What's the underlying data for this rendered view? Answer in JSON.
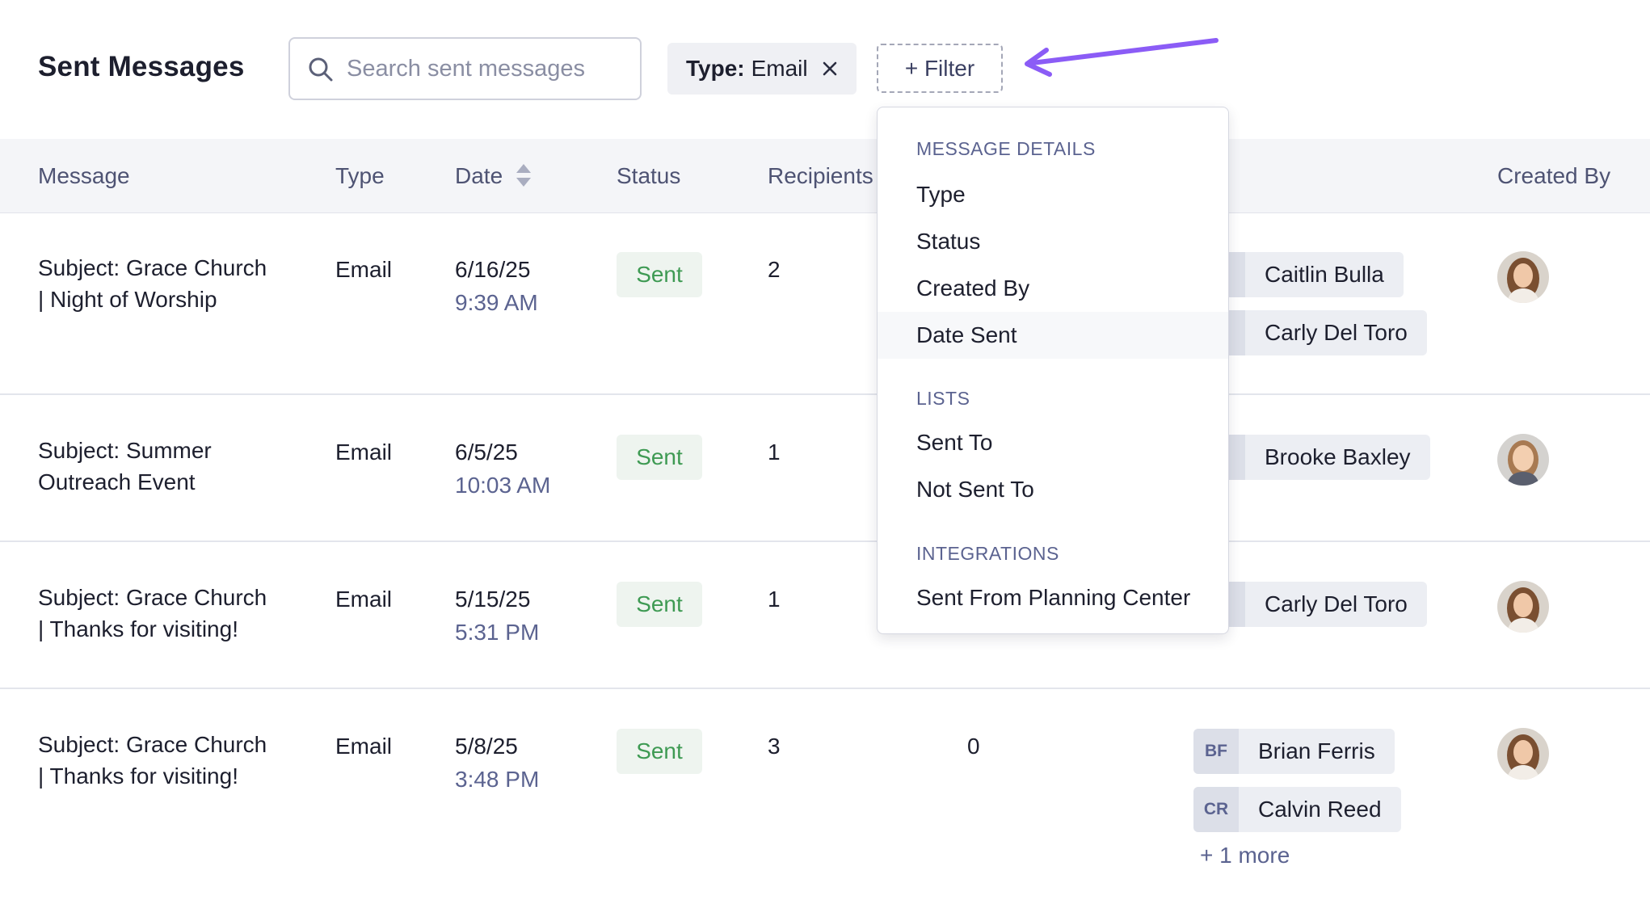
{
  "header": {
    "title": "Sent Messages",
    "search_placeholder": "Search sent messages",
    "type_filter": {
      "key": "Type:",
      "value": "Email"
    },
    "filter_button": "+ Filter"
  },
  "table": {
    "columns": {
      "message": "Message",
      "type": "Type",
      "date": "Date",
      "status": "Status",
      "recipients": "Recipients",
      "created_by": "Created By"
    },
    "rows": [
      {
        "subject_line1": "Subject: Grace Church",
        "subject_line2": "| Night of Worship",
        "type": "Email",
        "date": "6/16/25",
        "time": "9:39 AM",
        "status": "Sent",
        "recipients": "2",
        "sent_to": [
          {
            "initials": "",
            "name": "Caitlin Bulla"
          },
          {
            "initials": "",
            "name": "Carly Del Toro"
          }
        ]
      },
      {
        "subject_line1": "Subject: Summer",
        "subject_line2": "Outreach Event",
        "type": "Email",
        "date": "6/5/25",
        "time": "10:03 AM",
        "status": "Sent",
        "recipients": "1",
        "sent_to": [
          {
            "initials": "",
            "name": "Brooke Baxley"
          }
        ]
      },
      {
        "subject_line1": "Subject: Grace Church",
        "subject_line2": "| Thanks for visiting!",
        "type": "Email",
        "date": "5/15/25",
        "time": "5:31 PM",
        "status": "Sent",
        "recipients": "1",
        "sent_to": [
          {
            "initials": "",
            "name": "Carly Del Toro"
          }
        ]
      },
      {
        "subject_line1": "Subject: Grace Church",
        "subject_line2": "| Thanks for visiting!",
        "type": "Email",
        "date": "5/8/25",
        "time": "3:48 PM",
        "status": "Sent",
        "recipients": "3",
        "not_sent": "0",
        "sent_to": [
          {
            "initials": "BF",
            "name": "Brian Ferris"
          },
          {
            "initials": "CR",
            "name": "Calvin Reed"
          }
        ],
        "more": "+ 1 more"
      }
    ]
  },
  "filter_menu": {
    "sections": [
      {
        "label": "MESSAGE DETAILS",
        "items": [
          "Type",
          "Status",
          "Created By",
          "Date Sent"
        ]
      },
      {
        "label": "LISTS",
        "items": [
          "Sent To",
          "Not Sent To"
        ]
      },
      {
        "label": "INTEGRATIONS",
        "items": [
          "Sent From Planning Center"
        ]
      }
    ]
  },
  "colors": {
    "accent_arrow": "#8b5cf6",
    "status_green": "#3e9a53",
    "header_bg": "#f4f5f8"
  }
}
